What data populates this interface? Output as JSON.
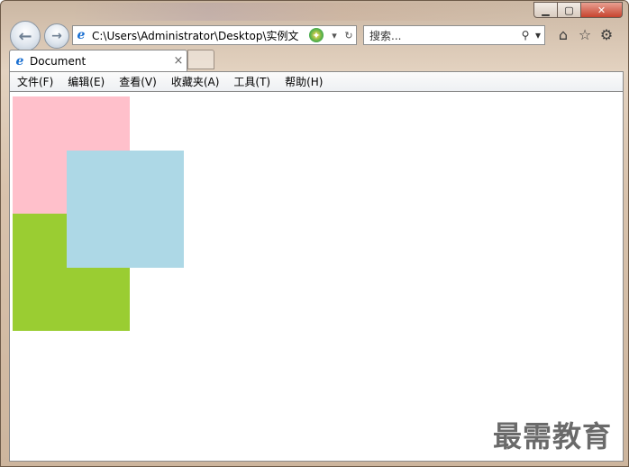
{
  "window": {
    "caption_min": "▁",
    "caption_max": "▢",
    "caption_close": "✕"
  },
  "nav": {
    "back_glyph": "←",
    "forward_glyph": "→"
  },
  "address": {
    "value": "C:\\Users\\Administrator\\Desktop\\实例文",
    "favicon": "e",
    "compat_glyph": "✦",
    "drop_glyph": "▾",
    "refresh_glyph": "↻"
  },
  "search": {
    "placeholder": "搜索...",
    "icon_glyph": "⚲",
    "drop_glyph": "▾"
  },
  "toolbar_icons": {
    "home": "⌂",
    "favorites": "☆",
    "settings": "⚙"
  },
  "tab": {
    "title": "Document",
    "close_glyph": "×",
    "favicon": "e"
  },
  "menu": [
    "文件(F)",
    "编辑(E)",
    "查看(V)",
    "收藏夹(A)",
    "工具(T)",
    "帮助(H)"
  ],
  "content": {
    "boxes": [
      {
        "name": "pink",
        "color": "#ffc0cb"
      },
      {
        "name": "green",
        "color": "#9acd32"
      },
      {
        "name": "blue",
        "color": "#add8e6"
      }
    ]
  },
  "watermark": "最需教育"
}
